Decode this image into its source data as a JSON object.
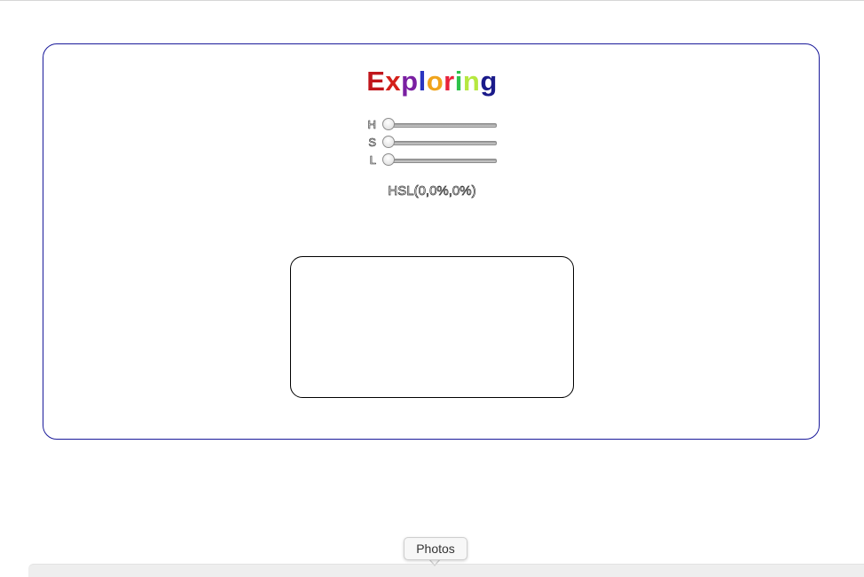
{
  "title": {
    "letters": [
      "E",
      "x",
      "p",
      "l",
      "o",
      "r",
      "i",
      "n",
      "g"
    ],
    "colors": [
      "#c0161c",
      "#d4201a",
      "#7a1fa2",
      "#2a35c0",
      "#f0a41c",
      "#e8223a",
      "#2ec24a",
      "#b6e840",
      "#1a1a8a"
    ]
  },
  "sliders": [
    {
      "label": "H",
      "value": 0
    },
    {
      "label": "S",
      "value": 0
    },
    {
      "label": "L",
      "value": 0
    }
  ],
  "readout": "HSL(0,0%,0%)",
  "swatch_color": "#ffffff",
  "dock": {
    "tooltip": "Photos"
  },
  "colors": {
    "panel_border": "#1a1a9a",
    "swatch_border": "#000000"
  }
}
